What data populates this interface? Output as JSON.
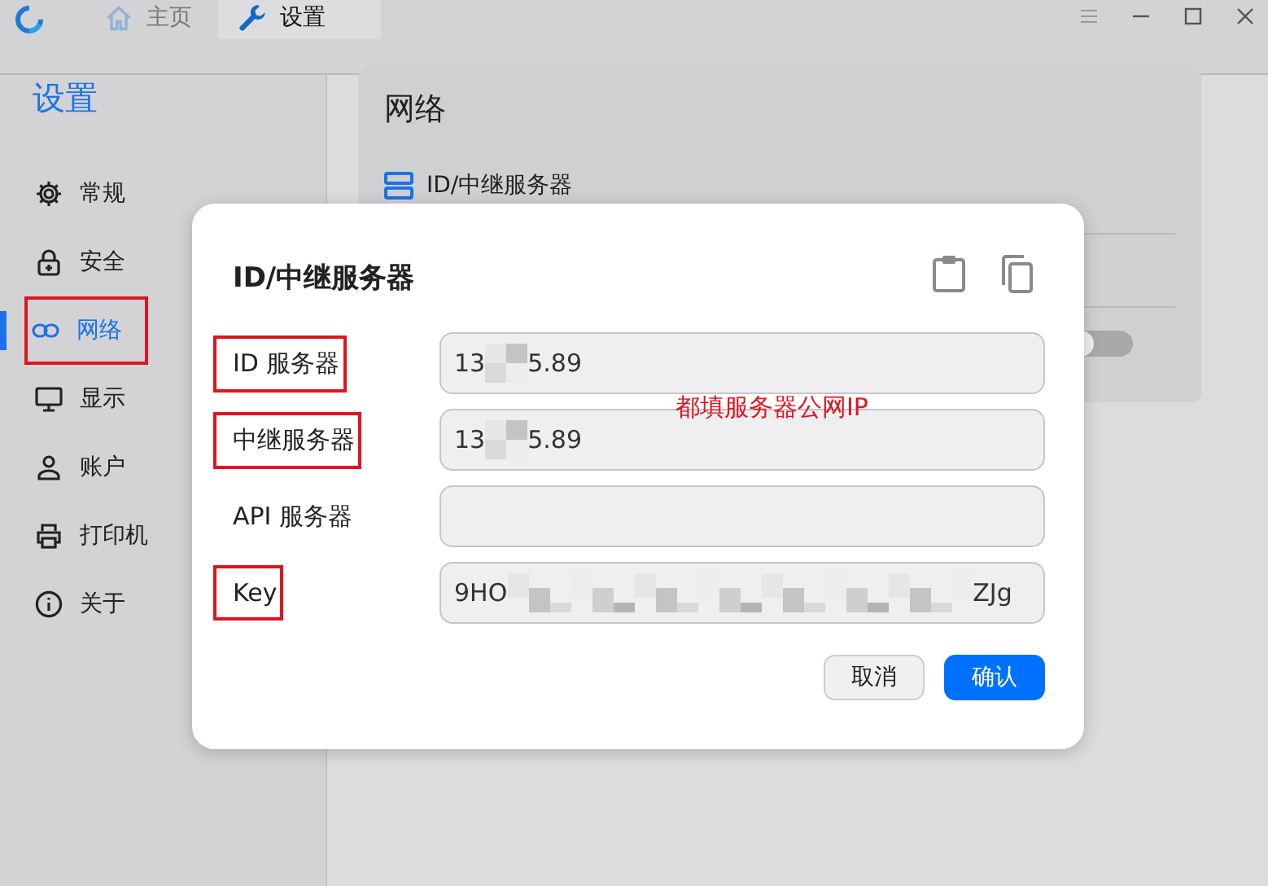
{
  "tabs": [
    {
      "label": "主页",
      "selected": false
    },
    {
      "label": "设置",
      "selected": true
    }
  ],
  "sidebar": {
    "title": "设置",
    "items": [
      {
        "label": "常规",
        "selected": false,
        "annotated": false
      },
      {
        "label": "安全",
        "selected": false,
        "annotated": false
      },
      {
        "label": "网络",
        "selected": true,
        "annotated": true
      },
      {
        "label": "显示",
        "selected": false,
        "annotated": false
      },
      {
        "label": "账户",
        "selected": false,
        "annotated": false
      },
      {
        "label": "打印机",
        "selected": false,
        "annotated": false
      },
      {
        "label": "关于",
        "selected": false,
        "annotated": false
      }
    ]
  },
  "card": {
    "title": "网络",
    "row": "ID/中继服务器",
    "toggle": {
      "on": false
    }
  },
  "dialog": {
    "title": "ID/中继服务器",
    "fields": [
      {
        "label": "ID 服务器",
        "annotated": true,
        "kind": "ip",
        "prefix": "13",
        "suffix": "5.89"
      },
      {
        "label": "中继服务器",
        "annotated": true,
        "kind": "ip",
        "prefix": "13",
        "suffix": "5.89"
      },
      {
        "label": "API 服务器",
        "annotated": false,
        "kind": "empty"
      },
      {
        "label": "Key",
        "annotated": true,
        "kind": "key",
        "prefix": "9HO",
        "suffix": "ZJg"
      }
    ],
    "note": "都填服务器公网IP",
    "buttons": [
      {
        "label": "取消",
        "primary": false
      },
      {
        "label": "确认",
        "primary": true
      }
    ]
  }
}
